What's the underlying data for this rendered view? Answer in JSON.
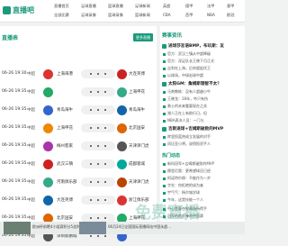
{
  "site": {
    "logo_text": "直播吧"
  },
  "nav": {
    "row1": [
      "直播首页",
      "足球直播",
      "篮球直播",
      "足球新闻",
      "英超",
      "德甲",
      "法甲",
      "意甲"
    ],
    "row2": [
      "全部比赛",
      "足球录像",
      "篮球录像",
      "篮球新闻",
      "CBA",
      "西甲",
      "NBA",
      "欧冠"
    ]
  },
  "left": {
    "title": "直播表",
    "more_label": "更多直播"
  },
  "matches": [
    {
      "time": "06-26 19:30",
      "league": "中超",
      "home": "上海海港",
      "away": "大连英博"
    },
    {
      "time": "06-26 19:35",
      "league": "中超",
      "home": "",
      "away": "上海申花"
    },
    {
      "time": "06-26 19:35",
      "league": "中超",
      "home": "青岛海牛",
      "away": "青岛海牛"
    },
    {
      "time": "06-26 19:35",
      "league": "中超",
      "home": "上海申花",
      "away": "北京国安"
    },
    {
      "time": "06-26 19:35",
      "league": "中超",
      "home": "梅州客家",
      "away": "天津津门虎"
    },
    {
      "time": "06-26 19:35",
      "league": "中超",
      "home": "武汉三镇",
      "away": "成都蓉城"
    },
    {
      "time": "06-26 19:35",
      "league": "中超",
      "home": "河南俱乐部",
      "away": "天津津门虎"
    },
    {
      "time": "06-26 19:35",
      "league": "中超",
      "home": "大连英博",
      "away": "浙江俱乐部"
    },
    {
      "time": "06-26 19:35",
      "league": "中超",
      "home": "北京国安",
      "away": "上海申花"
    },
    {
      "time": "06-26 19:35",
      "league": "中超",
      "home": "深圳新鹏城",
      "away": ""
    }
  ],
  "right": {
    "title": "赛事资讯",
    "headline1": "进球莎言语BMP，布玖斯：友",
    "lines1": [
      "官方：武汉三镇从中超降级",
      "官方：深足队长王晓下月正式",
      "吉利在上海，后申超起伏王",
      "以球场，中球宏球中超"
    ],
    "headline2": "太阳GM：詹姆斯理智不太？",
    "lines2": [
      "马刺教练：没有人超越小牛",
      "王晓龙：18年，咋只有伤",
      "勇士的未来重要现在之关",
      "湖人正在上有助行日，但",
      "NBA表决人员：一门与"
    ],
    "headline3": "吉斯进球+吉姆斯破败的MVP",
    "lines3": [
      "库里投篮热成立发展的对手",
      "冈比亚小将，说得投资手人"
    ],
    "section2": "热门动态",
    "lines4": [
      "新科冠军+吉姆斯破败的MVP",
      "穆里尼奥：更希望球员已经",
      "阿诺特尔俱：不能作为一步",
      "字先：你拒绝把成为者",
      "宇气气：杨尔城学球",
      "今年，这是技能一个人"
    ],
    "lines5": [
      "中心是赛在现赛场所得手",
      "冠军的的前锋的中国赛"
    ]
  },
  "bottom": {
    "text1": "欧洲杯前瞻4小组赛积分5战利刃…",
    "text2": "06月24日全国国际直播网站中国永超…"
  },
  "watermark": "免费直播"
}
